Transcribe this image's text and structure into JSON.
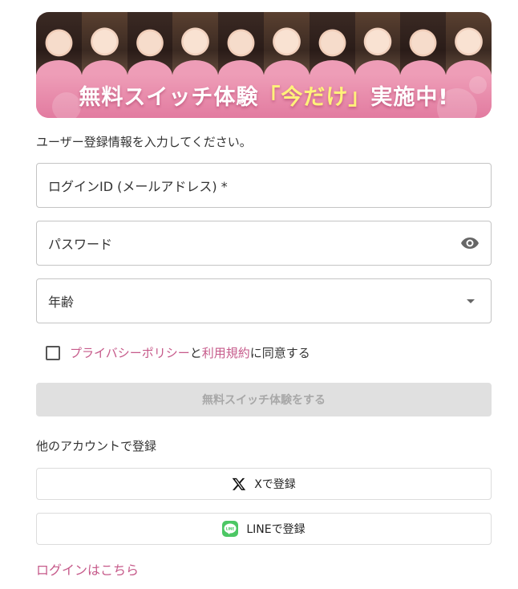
{
  "banner": {
    "title_before": "無料スイッチ体験",
    "title_highlight": "「今だけ」",
    "title_after": "実施中!"
  },
  "form": {
    "intro": "ユーザー登録情報を入力してください。",
    "login_id_placeholder": "ログインID (メールアドレス) *",
    "password_placeholder": "パスワード",
    "age_placeholder": "年齢",
    "privacy_link": "プライバシーポリシー",
    "and_text": "と",
    "terms_link": "利用規約",
    "agree_suffix": "に同意する",
    "submit_label": "無料スイッチ体験をする"
  },
  "social": {
    "heading": "他のアカウントで登録",
    "x_label": "Xで登録",
    "line_label": "LINEで登録",
    "line_icon_text": "LINE"
  },
  "footer": {
    "login_link": "ログインはこちら"
  },
  "colors": {
    "accent": "#c65a8a",
    "line_green": "#4cc764",
    "banner_pink": "#e47ca0"
  }
}
